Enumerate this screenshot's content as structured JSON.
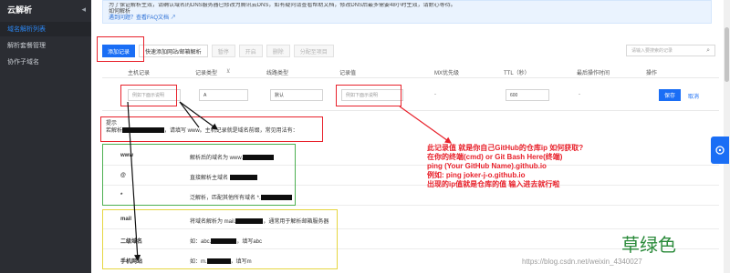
{
  "sidebar": {
    "title": "云解析",
    "items": [
      {
        "label": "域名解析列表",
        "active": true
      },
      {
        "label": "解析套餐管理",
        "active": false
      },
      {
        "label": "协作子域名",
        "active": false
      }
    ]
  },
  "notice": {
    "line1": "为了保证解析生效，请确认域名的DNS服务器已修改为腾讯云DNS，如有疑问请查看帮助文档，修改DNS后最多需要48小时生效，请耐心等待。",
    "line2": "如何解析",
    "faq_link": "遇到问题？查看FAQ文档"
  },
  "toolbar": {
    "add_record": "添加记录",
    "quick_add": "快速添加网站/邮箱解析",
    "pause": "暂停",
    "enable": "开启",
    "delete": "删除",
    "assign_group": "分配至项目",
    "search_placeholder": "请输入要搜索的记录"
  },
  "table": {
    "headers": [
      "主机记录",
      "记录类型",
      "线路类型",
      "记录值",
      "MX优先级",
      "TTL（秒）",
      "最后操作时间",
      "操作"
    ],
    "edit_row": {
      "host_placeholder": "例如下面示说明",
      "type_value": "A",
      "line_value": "默认",
      "value_placeholder": "例如下面示说明",
      "mx_value": "-",
      "ttl_value": "600",
      "time_value": "-",
      "save": "保存",
      "cancel": "取消"
    }
  },
  "hint": {
    "title": "提示",
    "text_prefix": "若解析",
    "text_suffix": "，请填写 www。主机记录就是域名前缀，常见用法有："
  },
  "host_examples": [
    {
      "key": "www",
      "desc": "解析后的域名为 www."
    },
    {
      "key": "@",
      "desc": "直接解析主域名"
    },
    {
      "key": "*",
      "desc": "泛解析，匹配其他所有域名 *."
    },
    {
      "key": "mail",
      "desc": "将域名解析为 mail.",
      "desc_suffix": "，通常用于解析邮箱服务器"
    },
    {
      "key": "二级域名",
      "desc": "如：abc.",
      "desc_suffix": "，填写abc"
    },
    {
      "key": "手机网站",
      "desc": "如：m.",
      "desc_suffix": "，填写m"
    }
  ],
  "annotation": "此记录值 就是你自己GitHub的仓库ip 如何获取?\n在你的终端(cmd) or Git Bash Here(终端)\nping (Your GitHub Name).github.io\n例如: ping joker-j-o.github.io\n出现的ip值就是仓库的值 输入进去就行啦",
  "watermark": {
    "big_text": "草绿色",
    "url": "https://blog.csdn.net/weixin_4340027"
  },
  "colors": {
    "primary": "#1a6ef5",
    "sidebar_bg": "#2b2d33",
    "annotation_red": "#e8212b",
    "green_box": "#4caf50",
    "yellow_box": "#e6d640"
  }
}
